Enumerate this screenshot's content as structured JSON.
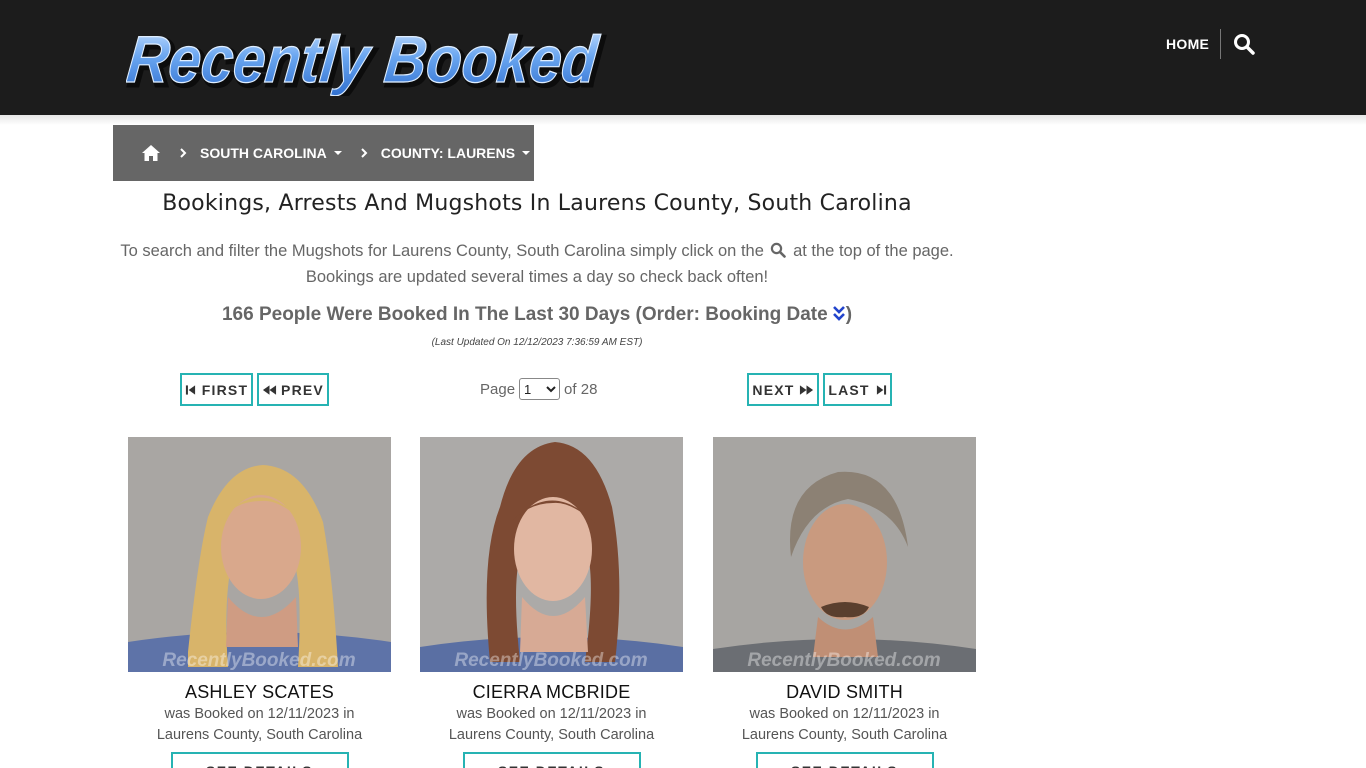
{
  "header": {
    "logo_text": "Recently Booked",
    "nav_home": "HOME",
    "search_icon": "search-icon"
  },
  "breadcrumb": {
    "home_icon": "home-icon",
    "state": "SOUTH CAROLINA",
    "county": "COUNTY: LAURENS"
  },
  "page": {
    "title": "Bookings, Arrests And Mugshots In Laurens County, South Carolina",
    "intro_part1": "To search and filter the Mugshots for Laurens County, South Carolina simply click on the",
    "intro_part2": "at the top of the page.",
    "intro_line2": "Bookings are updated several times a day so check back often!",
    "count_text": "166 People Were Booked In The Last 30 Days (Order: Booking Date",
    "count_close": ")",
    "last_updated": "(Last Updated On 12/12/2023 7:36:59 AM EST)"
  },
  "pagination": {
    "first": "FIRST",
    "prev": "PREV",
    "next": "NEXT",
    "last": "LAST",
    "page_label": "Page",
    "current_page": "1",
    "of_label": "of 28"
  },
  "bookings": [
    {
      "name": "ASHLEY SCATES",
      "booked_line": "was Booked on 12/11/2023 in",
      "location": "Laurens County, South Carolina",
      "details_label": "SEE DETAILS"
    },
    {
      "name": "CIERRA MCBRIDE",
      "booked_line": "was Booked on 12/11/2023 in",
      "location": "Laurens County, South Carolina",
      "details_label": "SEE DETAILS"
    },
    {
      "name": "DAVID SMITH",
      "booked_line": "was Booked on 12/11/2023 in",
      "location": "Laurens County, South Carolina",
      "details_label": "SEE DETAILS"
    }
  ],
  "watermark": "RecentlyBooked.com",
  "colors": {
    "header_bg": "#1c1c1c",
    "breadcrumb_bg": "#666666",
    "button_border": "#26b3b3",
    "logo_blue": "#5a9ae8"
  }
}
